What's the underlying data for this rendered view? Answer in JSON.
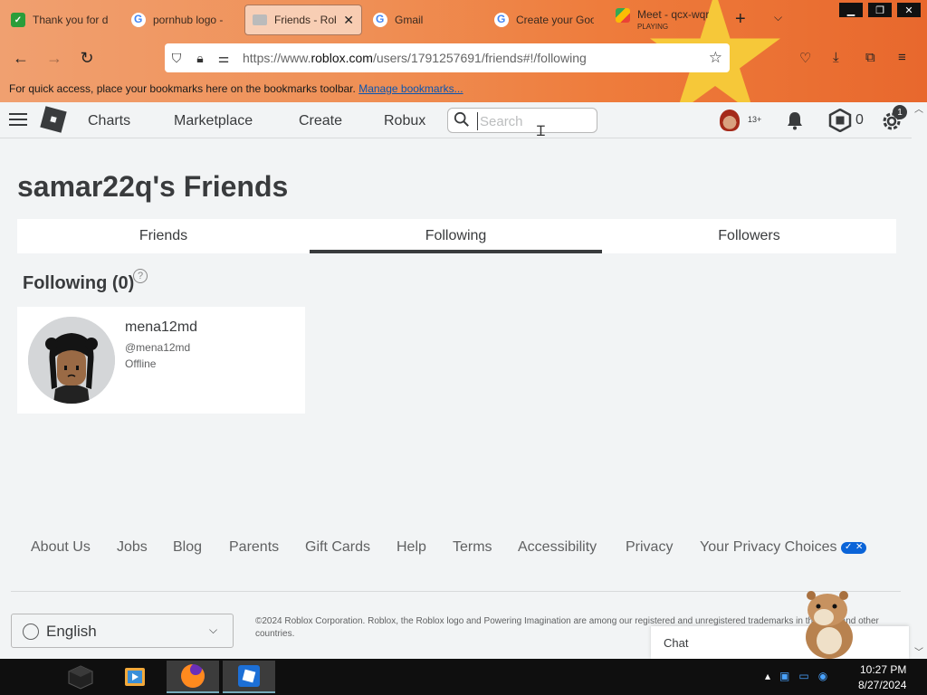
{
  "browser": {
    "tabs": [
      {
        "title": "Thank you for d",
        "icon": "roblox-green-icon",
        "active": false
      },
      {
        "title": "pornhub logo -",
        "icon": "google-icon",
        "active": false
      },
      {
        "title": "Friends - Robl",
        "icon": "page-icon",
        "active": true
      },
      {
        "title": "Gmail",
        "icon": "google-icon",
        "active": false
      },
      {
        "title": "Create your Goo",
        "icon": "google-icon",
        "active": false
      },
      {
        "title": "Meet - qcx-wqr",
        "subtitle": "PLAYING",
        "icon": "meet-icon",
        "active": false
      }
    ],
    "new_tab": "+",
    "url_prefix": "https://www.",
    "url_domain": "roblox.com",
    "url_path": "/users/1791257691/friends#!/following",
    "bookmarks_text": "For quick access, place your bookmarks here on the bookmarks toolbar.",
    "bookmarks_link": "Manage bookmarks..."
  },
  "header": {
    "nav": [
      "Charts",
      "Marketplace",
      "Create",
      "Robux"
    ],
    "search_placeholder": "Search",
    "age_label": "13+",
    "robux_count": "0",
    "settings_badge": "1"
  },
  "page": {
    "title": "samar22q's Friends",
    "tabs": [
      "Friends",
      "Following",
      "Followers"
    ],
    "active_tab": "Following",
    "section_title": "Following (0)",
    "help": "?",
    "friends": [
      {
        "name": "mena12md",
        "handle": "@mena12md",
        "status": "Offline"
      }
    ]
  },
  "footer": {
    "links": [
      "About Us",
      "Jobs",
      "Blog",
      "Parents",
      "Gift Cards",
      "Help",
      "Terms",
      "Accessibility",
      "Privacy",
      "Your Privacy Choices"
    ],
    "language": "English",
    "copyright": "©2024 Roblox Corporation. Roblox, the Roblox logo and Powering Imagination are among our registered and unregistered trademarks in the U.S. and other countries.",
    "chat": "Chat"
  },
  "taskbar": {
    "time": "10:27 PM",
    "date": "8/27/2024"
  },
  "colors": {
    "chrome_orange": "#ee7c3c",
    "roblox_text": "#393b3d",
    "page_bg": "#f2f4f5",
    "privacy_blue": "#0b64d8"
  }
}
